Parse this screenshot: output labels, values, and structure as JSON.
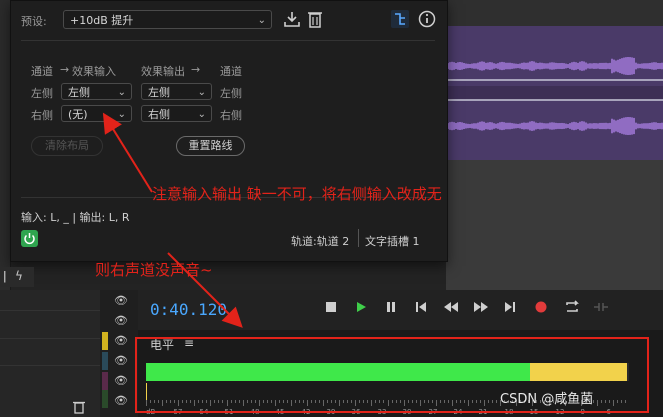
{
  "colors": {
    "annotation": "#e2231a",
    "meter_green": "#3fe84a",
    "meter_yellow": "#f2d24b",
    "time_blue": "#4aa8ff",
    "power_green": "#2fa44f",
    "record_red": "#e23b3b",
    "waveform": "#a77de0"
  },
  "panel": {
    "preset_label": "预设:",
    "preset_value": "+10dB 提升",
    "icons": [
      "save-preset-icon",
      "delete-preset-icon",
      "routing-icon",
      "info-icon"
    ],
    "routing": {
      "header_col1": "通道",
      "header_arrow1": "→",
      "header_col2": "效果输入",
      "header_col3": "效果输出",
      "header_arrow2": "→",
      "header_col4": "通道",
      "row_left_label": "左侧",
      "row_left_input": "左侧",
      "row_left_output": "左侧",
      "row_left_channel": "左侧",
      "row_right_label": "右侧",
      "row_right_input": "(无)",
      "row_right_output": "右侧",
      "row_right_channel": "右侧"
    },
    "clear_button": "清除布局",
    "reset_button": "重置路线",
    "io_summary": "输入: L, _ | 输出: L, R",
    "track_info": "轨道:轨道 2",
    "slot_info": "文字插槽 1"
  },
  "transport": {
    "time": "0:40.120"
  },
  "level_panel": {
    "title": "电平",
    "menu_icon": "≡",
    "green_fraction": 0.795,
    "yellow_fraction": 0.2,
    "scale": [
      "dB",
      "-57",
      "-54",
      "-51",
      "-48",
      "-45",
      "-42",
      "-39",
      "-36",
      "-33",
      "-30",
      "-27",
      "-24",
      "-21",
      "-18",
      "-15",
      "-12",
      "-9",
      "-6"
    ]
  },
  "annotations": {
    "note1": "注意输入输出 缺一不可，将右侧输入改成无",
    "note2": "则右声道没声音~"
  },
  "watermark": "CSDN @咸鱼菌"
}
